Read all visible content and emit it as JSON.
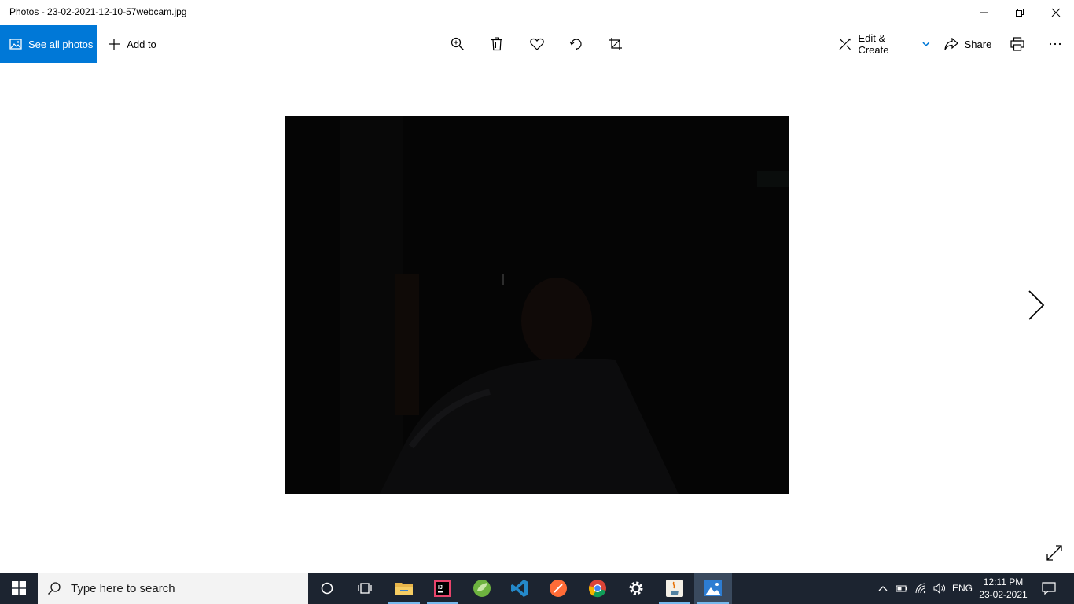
{
  "window": {
    "title": "Photos - 23-02-2021-12-10-57webcam.jpg",
    "controls": [
      "minimize-icon",
      "restore-icon",
      "close-icon"
    ]
  },
  "toolbar": {
    "see_all_label": "See all photos",
    "add_to_label": "Add to",
    "center_icons": [
      "zoom-in-icon",
      "delete-icon",
      "favorite-icon",
      "rotate-icon",
      "crop-icon"
    ],
    "edit_create_label": "Edit & Create",
    "share_label": "Share",
    "accent": "#0078d7"
  },
  "viewer": {
    "nav_next": "chevron-right-icon",
    "expand": "fullscreen-icon"
  },
  "taskbar": {
    "search_placeholder": "Type here to search",
    "apps": [
      "cortana-icon",
      "task-view-icon",
      "file-explorer-icon",
      "intellij-icon",
      "spring-icon",
      "vscode-icon",
      "postman-icon",
      "chrome-icon",
      "settings-icon",
      "java-icon",
      "photos-icon"
    ],
    "language": "ENG",
    "time": "12:11 PM",
    "date": "23-02-2021"
  }
}
